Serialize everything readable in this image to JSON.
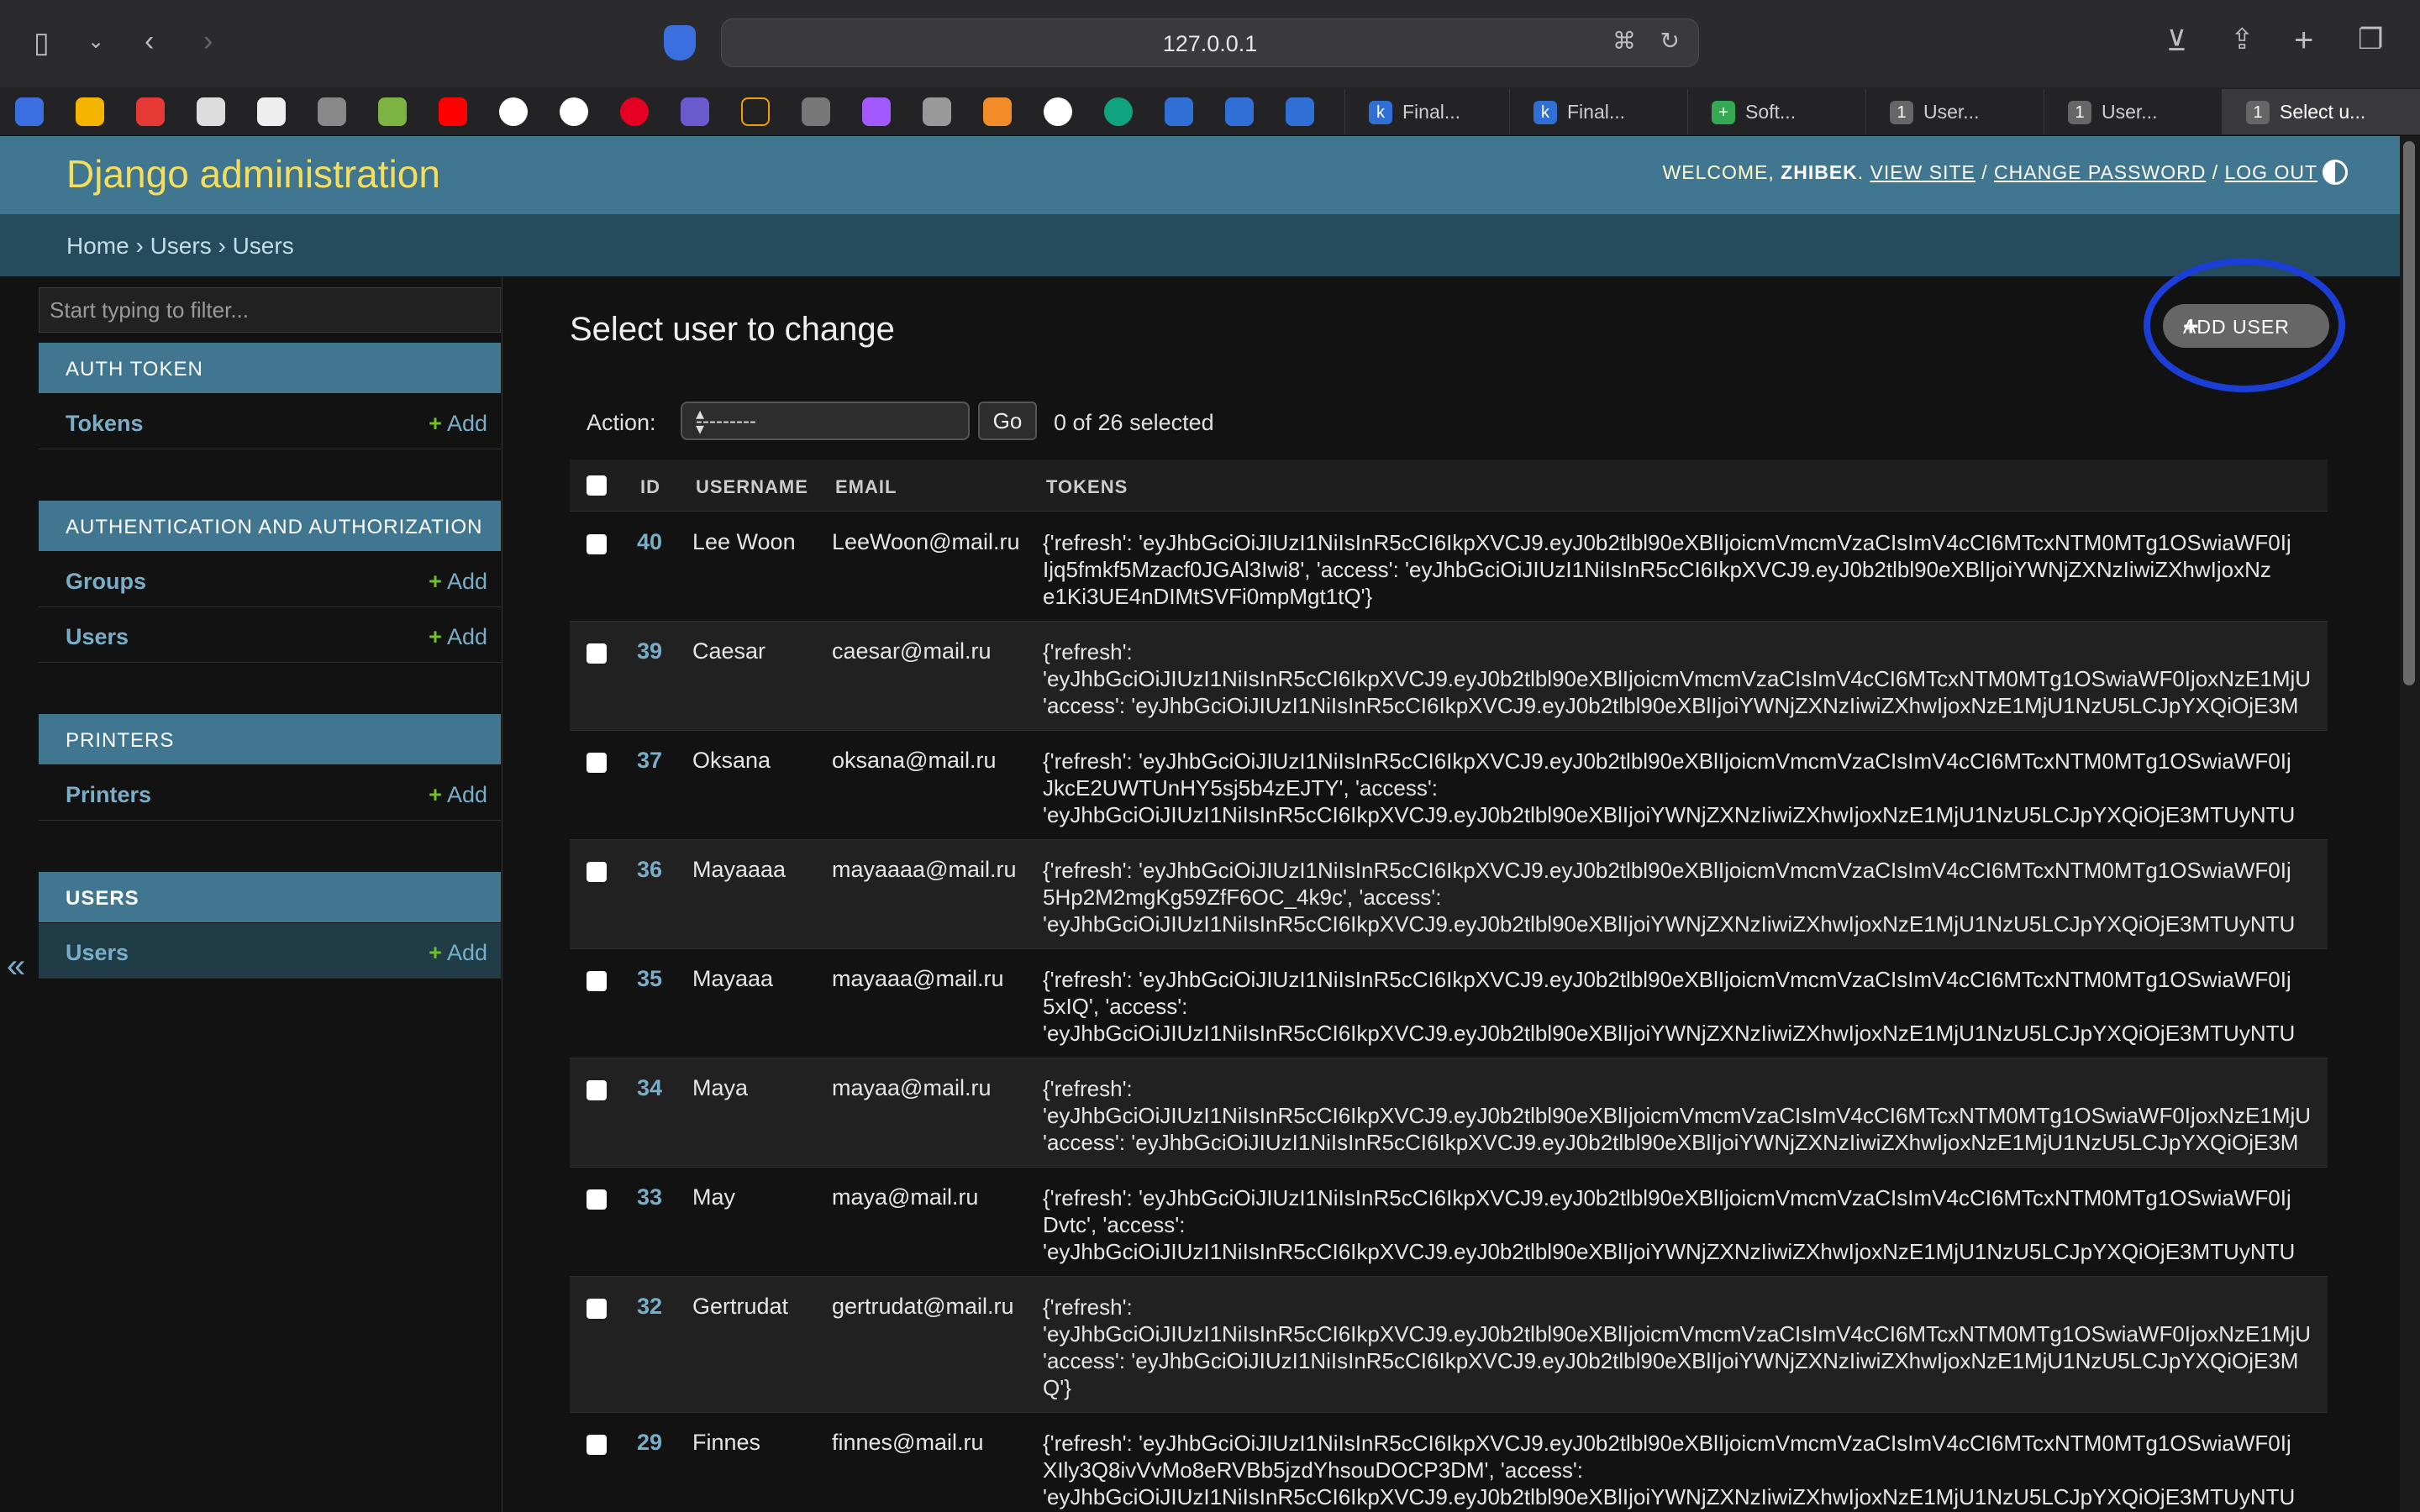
{
  "browser": {
    "url": "127.0.0.1",
    "tabs": [
      {
        "label": "Final...",
        "icon": "k"
      },
      {
        "label": "Final...",
        "icon": "k"
      },
      {
        "label": "Soft...",
        "icon": "+"
      },
      {
        "label": "User...",
        "icon": "1"
      },
      {
        "label": "User...",
        "icon": "1"
      },
      {
        "label": "Select u...",
        "icon": "1"
      }
    ]
  },
  "header": {
    "brand": "Django administration",
    "welcome": "WELCOME,",
    "user": "ZHIBEK",
    "view_site": "VIEW SITE",
    "change_password": "CHANGE PASSWORD",
    "log_out": "LOG OUT"
  },
  "breadcrumbs": "Home › Users › Users",
  "sidebar": {
    "filter_placeholder": "Start typing to filter...",
    "modules": [
      {
        "title": "AUTH TOKEN",
        "items": [
          {
            "name": "Tokens",
            "add": "Add"
          }
        ]
      },
      {
        "title": "AUTHENTICATION AND AUTHORIZATION",
        "items": [
          {
            "name": "Groups",
            "add": "Add"
          },
          {
            "name": "Users",
            "add": "Add"
          }
        ]
      },
      {
        "title": "PRINTERS",
        "items": [
          {
            "name": "Printers",
            "add": "Add"
          }
        ]
      },
      {
        "title": "USERS",
        "items": [
          {
            "name": "Users",
            "add": "Add"
          }
        ]
      }
    ]
  },
  "content": {
    "title": "Select user to change",
    "add_button": "ADD USER"
  },
  "actions": {
    "label": "Action:",
    "selected_option": "---------",
    "go": "Go",
    "counter": "0 of 26 selected"
  },
  "table": {
    "headers": {
      "id": "ID",
      "username": "USERNAME",
      "email": "EMAIL",
      "tokens": "TOKENS"
    },
    "rows": [
      {
        "id": "40",
        "username": "Lee Woon",
        "email": "LeeWoon@mail.ru",
        "tokens": "{'refresh': 'eyJhbGciOiJIUzI1NiIsInR5cCI6IkpXVCJ9.eyJ0b2tlbl90eXBlIjoicmVmcmVzaCIsImV4cCI6MTcxNTM0MTg1OSwiaWF0Ij\nIjq5fmkf5Mzacf0JGAl3Iwi8', 'access': 'eyJhbGciOiJIUzI1NiIsInR5cCI6IkpXVCJ9.eyJ0b2tlbl90eXBlIjoiYWNjZXNzIiwiZXhwIjoxNz\ne1Ki3UE4nDIMtSVFi0mpMgt1tQ'}"
      },
      {
        "id": "39",
        "username": "Caesar",
        "email": "caesar@mail.ru",
        "tokens": "{'refresh':\n'eyJhbGciOiJIUzI1NiIsInR5cCI6IkpXVCJ9.eyJ0b2tlbl90eXBlIjoicmVmcmVzaCIsImV4cCI6MTcxNTM0MTg1OSwiaWF0IjoxNzE1MjU\n'access': 'eyJhbGciOiJIUzI1NiIsInR5cCI6IkpXVCJ9.eyJ0b2tlbl90eXBlIjoiYWNjZXNzIiwiZXhwIjoxNzE1MjU1NzU5LCJpYXQiOjE3M"
      },
      {
        "id": "37",
        "username": "Oksana",
        "email": "oksana@mail.ru",
        "tokens": "{'refresh': 'eyJhbGciOiJIUzI1NiIsInR5cCI6IkpXVCJ9.eyJ0b2tlbl90eXBlIjoicmVmcmVzaCIsImV4cCI6MTcxNTM0MTg1OSwiaWF0Ij\nJkcE2UWTUnHY5sj5b4zEJTY', 'access':\n'eyJhbGciOiJIUzI1NiIsInR5cCI6IkpXVCJ9.eyJ0b2tlbl90eXBlIjoiYWNjZXNzIiwiZXhwIjoxNzE1MjU1NzU5LCJpYXQiOjE3MTUyNTU"
      },
      {
        "id": "36",
        "username": "Mayaaaa",
        "email": "mayaaaa@mail.ru",
        "tokens": "{'refresh': 'eyJhbGciOiJIUzI1NiIsInR5cCI6IkpXVCJ9.eyJ0b2tlbl90eXBlIjoicmVmcmVzaCIsImV4cCI6MTcxNTM0MTg1OSwiaWF0Ij\n5Hp2M2mgKg59ZfF6OC_4k9c', 'access':\n'eyJhbGciOiJIUzI1NiIsInR5cCI6IkpXVCJ9.eyJ0b2tlbl90eXBlIjoiYWNjZXNzIiwiZXhwIjoxNzE1MjU1NzU5LCJpYXQiOjE3MTUyNTU"
      },
      {
        "id": "35",
        "username": "Mayaaa",
        "email": "mayaaa@mail.ru",
        "tokens": "{'refresh': 'eyJhbGciOiJIUzI1NiIsInR5cCI6IkpXVCJ9.eyJ0b2tlbl90eXBlIjoicmVmcmVzaCIsImV4cCI6MTcxNTM0MTg1OSwiaWF0Ij\n5xIQ', 'access':\n'eyJhbGciOiJIUzI1NiIsInR5cCI6IkpXVCJ9.eyJ0b2tlbl90eXBlIjoiYWNjZXNzIiwiZXhwIjoxNzE1MjU1NzU5LCJpYXQiOjE3MTUyNTU"
      },
      {
        "id": "34",
        "username": "Maya",
        "email": "mayaa@mail.ru",
        "tokens": "{'refresh':\n'eyJhbGciOiJIUzI1NiIsInR5cCI6IkpXVCJ9.eyJ0b2tlbl90eXBlIjoicmVmcmVzaCIsImV4cCI6MTcxNTM0MTg1OSwiaWF0IjoxNzE1MjU\n'access': 'eyJhbGciOiJIUzI1NiIsInR5cCI6IkpXVCJ9.eyJ0b2tlbl90eXBlIjoiYWNjZXNzIiwiZXhwIjoxNzE1MjU1NzU5LCJpYXQiOjE3M"
      },
      {
        "id": "33",
        "username": "May",
        "email": "maya@mail.ru",
        "tokens": "{'refresh': 'eyJhbGciOiJIUzI1NiIsInR5cCI6IkpXVCJ9.eyJ0b2tlbl90eXBlIjoicmVmcmVzaCIsImV4cCI6MTcxNTM0MTg1OSwiaWF0Ij\nDvtc', 'access':\n'eyJhbGciOiJIUzI1NiIsInR5cCI6IkpXVCJ9.eyJ0b2tlbl90eXBlIjoiYWNjZXNzIiwiZXhwIjoxNzE1MjU1NzU5LCJpYXQiOjE3MTUyNTU"
      },
      {
        "id": "32",
        "username": "Gertrudat",
        "email": "gertrudat@mail.ru",
        "tokens": "{'refresh':\n'eyJhbGciOiJIUzI1NiIsInR5cCI6IkpXVCJ9.eyJ0b2tlbl90eXBlIjoicmVmcmVzaCIsImV4cCI6MTcxNTM0MTg1OSwiaWF0IjoxNzE1MjU\n'access': 'eyJhbGciOiJIUzI1NiIsInR5cCI6IkpXVCJ9.eyJ0b2tlbl90eXBlIjoiYWNjZXNzIiwiZXhwIjoxNzE1MjU1NzU5LCJpYXQiOjE3M\nQ'}"
      },
      {
        "id": "29",
        "username": "Finnes",
        "email": "finnes@mail.ru",
        "tokens": "{'refresh': 'eyJhbGciOiJIUzI1NiIsInR5cCI6IkpXVCJ9.eyJ0b2tlbl90eXBlIjoicmVmcmVzaCIsImV4cCI6MTcxNTM0MTg1OSwiaWF0Ij\nXIly3Q8ivVvMo8eRVBb5jzdYhsouDOCP3DM', 'access':\n'eyJhbGciOiJIUzI1NiIsInR5cCI6IkpXVCJ9.eyJ0b2tlbl90eXBlIjoiYWNjZXNzIiwiZXhwIjoxNzE1MjU1NzU5LCJpYXQiOjE3MTUyNTU"
      }
    ]
  },
  "colors": {
    "header_bg": "#417690",
    "brand_yellow": "#f5dd5d",
    "link_blue": "#79aec8",
    "add_green": "#70bf2b",
    "annotation_ring": "#1b3fd6"
  }
}
